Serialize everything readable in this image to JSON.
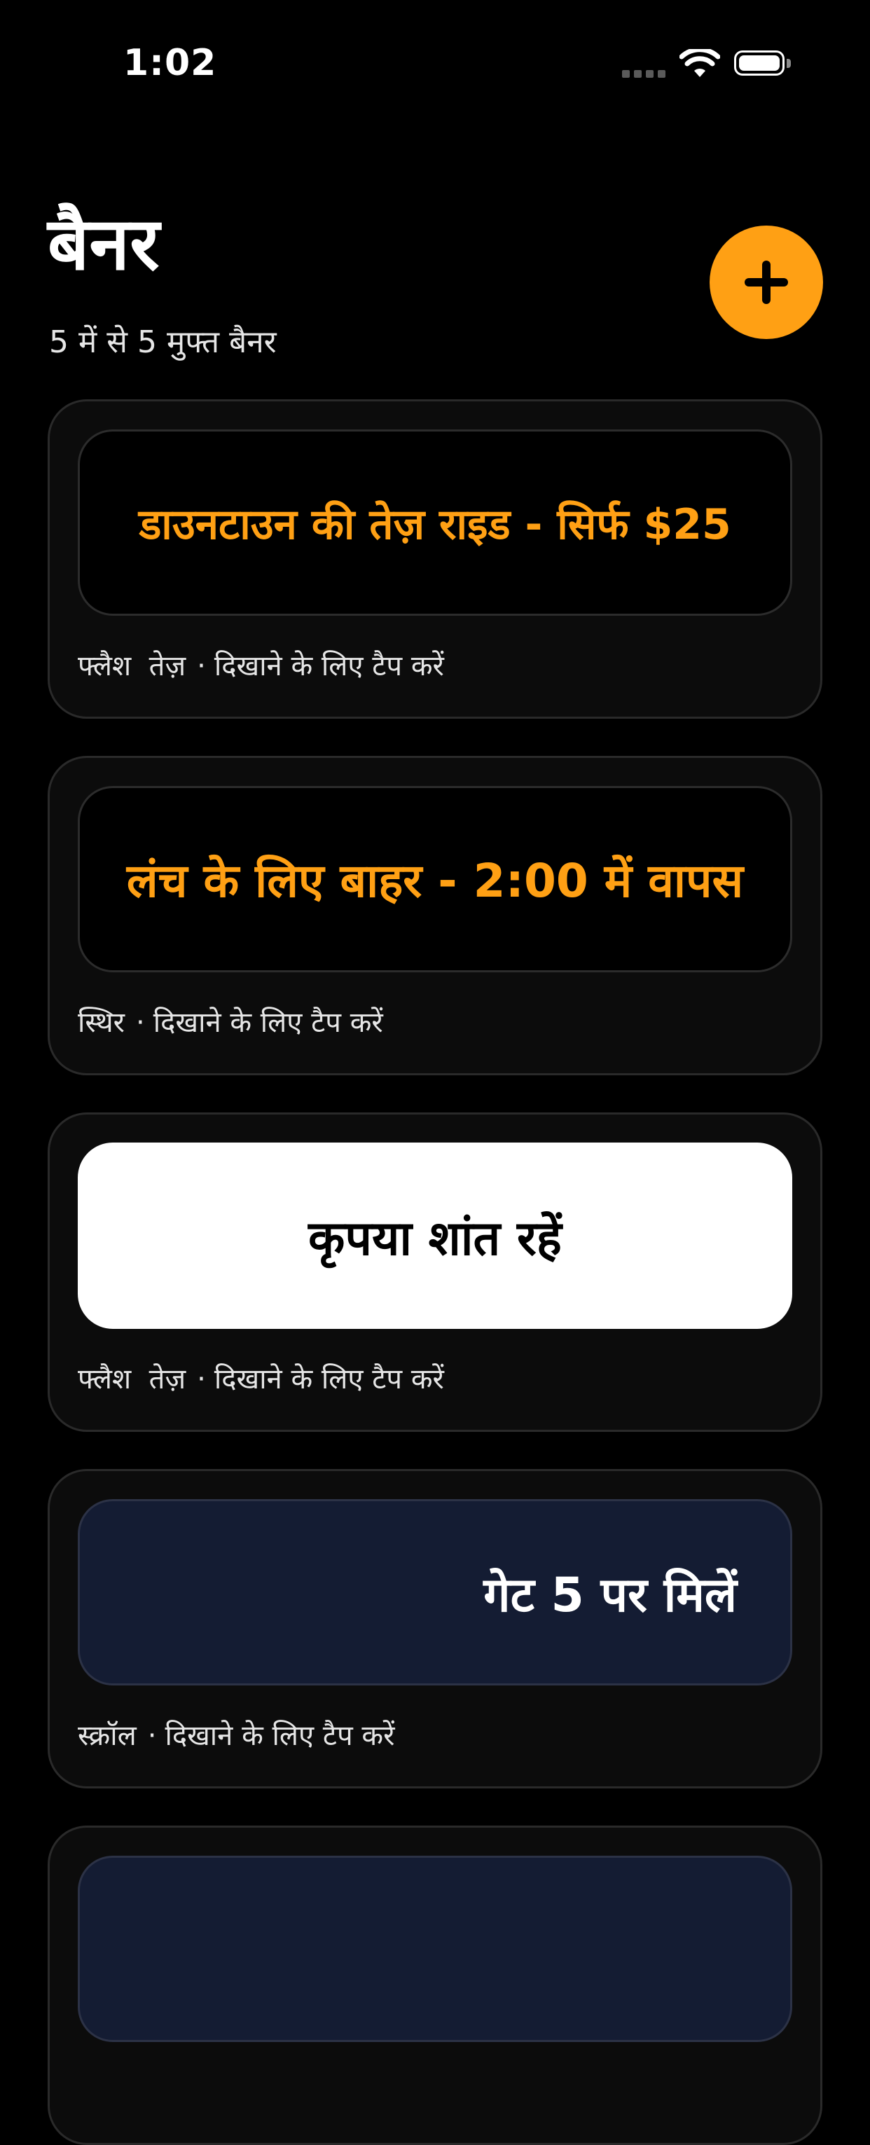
{
  "status_bar": {
    "time": "1:02",
    "icons": [
      "signal-icon",
      "wifi-icon",
      "battery-icon"
    ]
  },
  "header": {
    "title": "बैनर",
    "subtitle": "5 में से 5 मुफ्त बैनर",
    "add_button_icon": "plus-icon",
    "accent_color": "#FFA014"
  },
  "banners": [
    {
      "text": "डाउनटाउन की तेज़ राइड - सिर्फ $25",
      "mode": "फ्लैश  तेज़",
      "separator": "·",
      "hint": "दिखाने के लिए टैप करें",
      "background": "#000000",
      "text_color": "#FFA014"
    },
    {
      "text": "लंच के लिए बाहर - 2:00 में वापस",
      "mode": "स्थिर",
      "separator": "·",
      "hint": "दिखाने के लिए टैप करें",
      "background": "#000000",
      "text_color": "#FFA014"
    },
    {
      "text": "कृपया शांत रहें",
      "mode": "फ्लैश  तेज़",
      "separator": "·",
      "hint": "दिखाने के लिए टैप करें",
      "background": "#FFFFFF",
      "text_color": "#000000"
    },
    {
      "text": "गेट 5 पर मिलें",
      "mode": "स्क्रॉल",
      "separator": "·",
      "hint": "दिखाने के लिए टैप करें",
      "background": "#141C33",
      "text_color": "#FFFFFF"
    },
    {
      "text": "",
      "mode": "",
      "separator": "",
      "hint": "",
      "background": "#141C33",
      "text_color": "#FFFFFF"
    }
  ]
}
